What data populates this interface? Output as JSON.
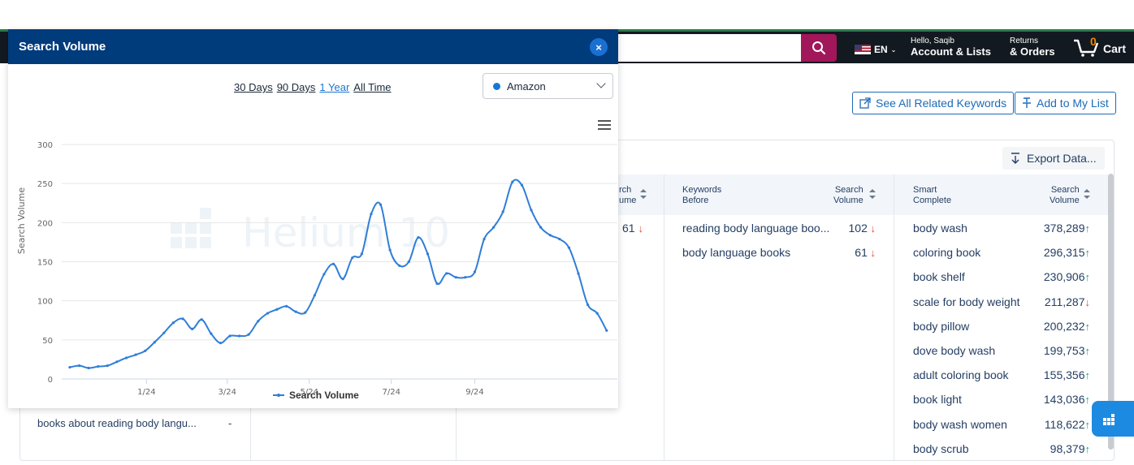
{
  "header": {
    "lang": "EN",
    "greeting": "Hello, Saqib",
    "account": "Account & Lists",
    "returns": "Returns",
    "orders": "& Orders",
    "cart_count": "0",
    "cart_label": "Cart"
  },
  "page": {
    "see_all": "See All Related Keywords",
    "add_list": "Add to My List",
    "export": "Export Data...",
    "columns": {
      "col1_search": "rch",
      "col1_volume": "ume",
      "before_title": "Keywords",
      "before_sub": "Before",
      "search": "Search",
      "volume": "Volume",
      "smart_title": "Smart",
      "smart_sub": "Complete"
    },
    "partial_value": "61",
    "bottom_keyword": "books about reading body langu...",
    "bottom_dash": "-",
    "before_rows": [
      {
        "keyword": "reading body language boo...",
        "volume": "102",
        "trend": "down"
      },
      {
        "keyword": "body language books",
        "volume": "61",
        "trend": "down"
      }
    ],
    "smart_rows": [
      {
        "keyword": "body wash",
        "volume": "378,289",
        "trend": "up"
      },
      {
        "keyword": "coloring book",
        "volume": "296,315",
        "trend": "up"
      },
      {
        "keyword": "book shelf",
        "volume": "230,906",
        "trend": "up"
      },
      {
        "keyword": "scale for body weight",
        "volume": "211,287",
        "trend": "down"
      },
      {
        "keyword": "body pillow",
        "volume": "200,232",
        "trend": "up"
      },
      {
        "keyword": "dove body wash",
        "volume": "199,753",
        "trend": "up"
      },
      {
        "keyword": "adult coloring book",
        "volume": "155,356",
        "trend": "up"
      },
      {
        "keyword": "book light",
        "volume": "143,036",
        "trend": "up"
      },
      {
        "keyword": "body wash women",
        "volume": "118,622",
        "trend": "up"
      },
      {
        "keyword": "body scrub",
        "volume": "98,379",
        "trend": "up"
      }
    ]
  },
  "modal": {
    "title": "Search Volume",
    "close": "×",
    "ranges": [
      "30 Days",
      "90 Days",
      "1 Year",
      "All Time"
    ],
    "active_range": "1 Year",
    "marketplace": "Amazon",
    "watermark": "Helium 10"
  },
  "colors": {
    "series": "#2f7ed8",
    "modal_header": "#003b7c",
    "up": "#1aa36b",
    "down": "#e4463a",
    "accent": "#1d6bb8"
  },
  "chart_data": {
    "type": "line",
    "title": "",
    "xlabel": "",
    "ylabel": "Search Volume",
    "ylim": [
      0,
      300
    ],
    "yticks": [
      0,
      50,
      100,
      150,
      200,
      250,
      300
    ],
    "xticks": [
      "1/24",
      "3/24",
      "5/24",
      "7/24",
      "9/24"
    ],
    "legend": "bottom-center",
    "grid": true,
    "series": [
      {
        "name": "Search Volume",
        "points": [
          [
            "2023-11-05",
            15
          ],
          [
            "2023-11-12",
            17
          ],
          [
            "2023-11-19",
            14
          ],
          [
            "2023-11-26",
            16
          ],
          [
            "2023-12-03",
            17
          ],
          [
            "2023-12-10",
            22
          ],
          [
            "2023-12-17",
            27
          ],
          [
            "2023-12-24",
            31
          ],
          [
            "2023-12-31",
            36
          ],
          [
            "2024-01-07",
            47
          ],
          [
            "2024-01-14",
            59
          ],
          [
            "2024-01-21",
            72
          ],
          [
            "2024-01-28",
            77
          ],
          [
            "2024-02-04",
            64
          ],
          [
            "2024-02-11",
            76
          ],
          [
            "2024-02-18",
            58
          ],
          [
            "2024-02-25",
            46
          ],
          [
            "2024-03-03",
            55
          ],
          [
            "2024-03-10",
            55
          ],
          [
            "2024-03-17",
            57
          ],
          [
            "2024-03-24",
            74
          ],
          [
            "2024-03-31",
            84
          ],
          [
            "2024-04-07",
            89
          ],
          [
            "2024-04-14",
            93
          ],
          [
            "2024-04-21",
            86
          ],
          [
            "2024-04-28",
            85
          ],
          [
            "2024-05-05",
            107
          ],
          [
            "2024-05-12",
            134
          ],
          [
            "2024-05-19",
            147
          ],
          [
            "2024-05-26",
            128
          ],
          [
            "2024-06-02",
            155
          ],
          [
            "2024-06-09",
            160
          ],
          [
            "2024-06-16",
            211
          ],
          [
            "2024-06-23",
            223
          ],
          [
            "2024-06-30",
            165
          ],
          [
            "2024-07-07",
            145
          ],
          [
            "2024-07-14",
            150
          ],
          [
            "2024-07-21",
            181
          ],
          [
            "2024-07-28",
            160
          ],
          [
            "2024-08-04",
            122
          ],
          [
            "2024-08-11",
            135
          ],
          [
            "2024-08-18",
            130
          ],
          [
            "2024-08-25",
            130
          ],
          [
            "2024-09-01",
            137
          ],
          [
            "2024-09-08",
            179
          ],
          [
            "2024-09-15",
            194
          ],
          [
            "2024-09-22",
            214
          ],
          [
            "2024-09-29",
            252
          ],
          [
            "2024-10-06",
            248
          ],
          [
            "2024-10-13",
            216
          ],
          [
            "2024-10-20",
            194
          ],
          [
            "2024-10-27",
            184
          ],
          [
            "2024-11-03",
            179
          ],
          [
            "2024-11-10",
            168
          ],
          [
            "2024-11-17",
            135
          ],
          [
            "2024-11-24",
            95
          ],
          [
            "2024-12-01",
            84
          ],
          [
            "2024-12-08",
            62
          ]
        ]
      }
    ]
  }
}
